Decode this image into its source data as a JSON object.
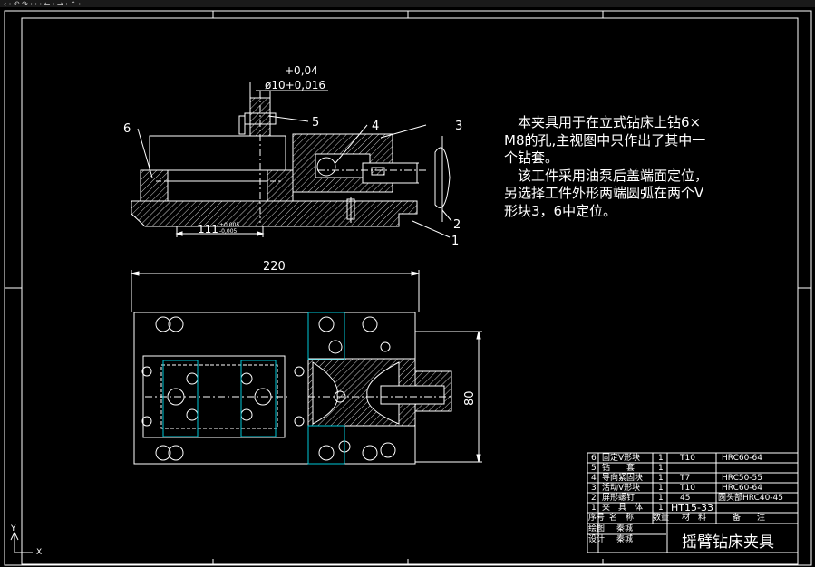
{
  "toolbar": {
    "fragment": "‹ · ↶ ↷ · · · ← · → · ↑ ·"
  },
  "dimensions": {
    "tol_upper": "+0,04",
    "hole_dia": "ø10+0,016",
    "len_111": "111",
    "tol_111_upper": "+0,005",
    "tol_111_lower": "-0,005",
    "width_220": "220",
    "height_80": "80"
  },
  "balloons": {
    "b1": "1",
    "b2": "2",
    "b3": "3",
    "b4": "4",
    "b5": "5",
    "b6": "6"
  },
  "note": {
    "p1": "　本夹具用于在立式钻床上钻6× M8的孔,主视图中只作出了其中一个钻套。",
    "p2": "　该工件采用油泵后盖端面定位，另选择工件外形两端圆弧在两个V形块3，6中定位。"
  },
  "bom": {
    "rows": [
      {
        "no": "6",
        "name": "固定V形块",
        "qty": "1",
        "material": "T10",
        "remark": "HRC60-64"
      },
      {
        "no": "5",
        "name": "钻　　套",
        "qty": "1",
        "material": "",
        "remark": ""
      },
      {
        "no": "4",
        "name": "导向紧固块",
        "qty": "1",
        "material": "T7",
        "remark": "HRC50-55"
      },
      {
        "no": "3",
        "name": "活动V形块",
        "qty": "1",
        "material": "T10",
        "remark": "HRC60-64"
      },
      {
        "no": "2",
        "name": "屏形螺钉",
        "qty": "1",
        "material": "45",
        "remark": "圆头部HRC40-45"
      },
      {
        "no": "1",
        "name": "夹　具　体",
        "qty": "1",
        "material": "HT15-33",
        "remark": ""
      }
    ],
    "header": {
      "no": "序号",
      "name": "名　称",
      "qty": "数量",
      "material": "材　料",
      "remark": "备　　注"
    },
    "roles": {
      "drafter_label": "绘图",
      "drafter": "秦城",
      "designer_label": "设计",
      "designer": "秦城"
    },
    "drawing_title": "摇臂钻床夹具"
  },
  "ucs_icon": {
    "y_label": "Y",
    "x_label": "X"
  },
  "colors": {
    "background": "#000000",
    "lines": "#ffffff",
    "hatch": "#ffffff",
    "cyan": "#00c8d8"
  }
}
